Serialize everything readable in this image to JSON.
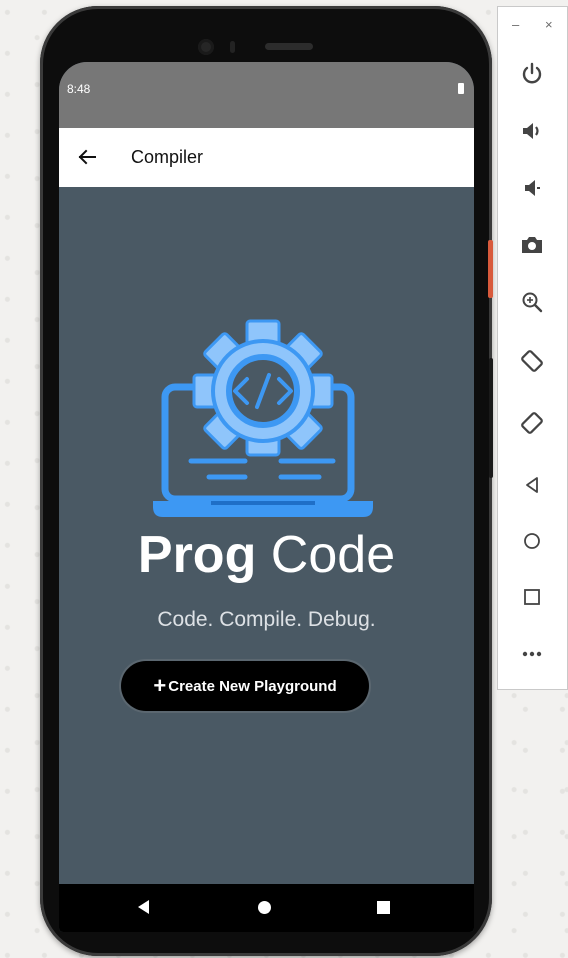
{
  "status_bar": {
    "time": "8:48"
  },
  "app_bar": {
    "title": "Compiler"
  },
  "hero": {
    "brand_bold": "Prog",
    "brand_light": "Code",
    "tagline": "Code. Compile. Debug.",
    "create_button_label": "Create New Playground",
    "logo_code_symbol": "</>"
  },
  "emulator_toolbar": {
    "window_minimize": "–",
    "window_close": "×",
    "tools": [
      "power-icon",
      "volume-up-icon",
      "volume-down-icon",
      "camera-icon",
      "zoom-icon",
      "rotate-left-icon",
      "rotate-right-icon",
      "back-icon",
      "home-icon",
      "overview-icon",
      "more-icon"
    ]
  },
  "colors": {
    "screen_background": "#4a5964",
    "logo_blue": "#3d98f3",
    "logo_light_blue": "#8fc5fb",
    "button_background": "#000000",
    "status_bar": "#777777"
  }
}
